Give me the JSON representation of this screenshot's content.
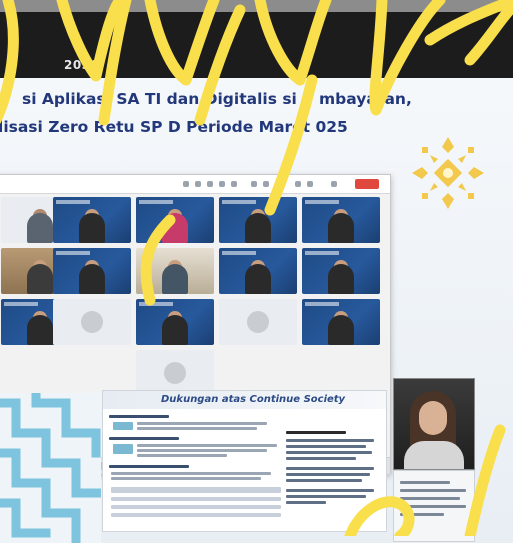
{
  "header": {
    "year_text": "2030"
  },
  "slide": {
    "title_line_1": "si Aplikasi SA TI dan Digitalis si P mbayaran,",
    "title_line_2": "lisasi Zero Retu SP D Periode Maret 025"
  },
  "document": {
    "title": "Dukungan atas Continue Society"
  },
  "colors": {
    "title_blue": "#22387a",
    "logo_gold": "#f2c94c",
    "scribble_yellow": "#f9df4b",
    "header_dark": "#1c1c1c"
  },
  "icons": {
    "logo": "gold-ornament-logo",
    "overlay": "yellow-handwriting-scribble"
  }
}
